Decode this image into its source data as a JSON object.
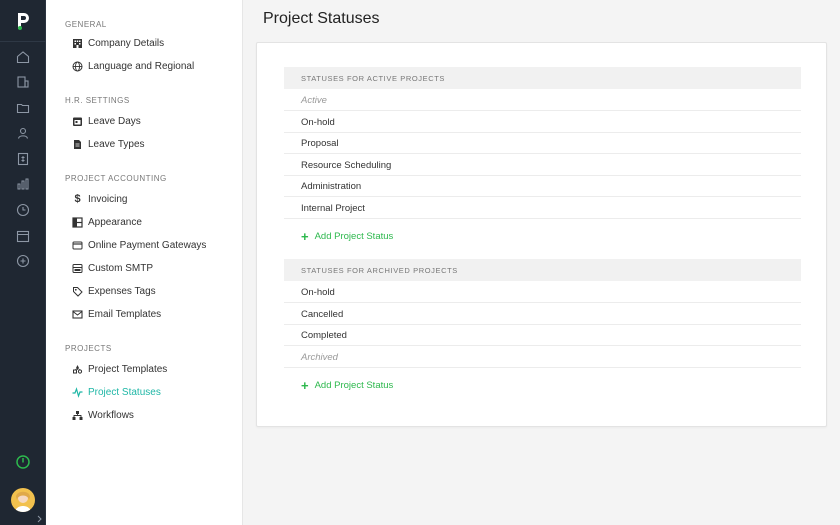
{
  "settings_nav": {
    "sections": [
      {
        "label": "GENERAL",
        "items": [
          {
            "label": "Company Details",
            "icon": "building-icon"
          },
          {
            "label": "Language and Regional",
            "icon": "globe-icon"
          }
        ]
      },
      {
        "label": "H.R. SETTINGS",
        "items": [
          {
            "label": "Leave Days",
            "icon": "calendar-icon"
          },
          {
            "label": "Leave Types",
            "icon": "file-icon"
          }
        ]
      },
      {
        "label": "PROJECT ACCOUNTING",
        "items": [
          {
            "label": "Invoicing",
            "icon": "dollar-icon"
          },
          {
            "label": "Appearance",
            "icon": "layout-icon"
          },
          {
            "label": "Online Payment Gateways",
            "icon": "card-icon"
          },
          {
            "label": "Custom SMTP",
            "icon": "server-icon"
          },
          {
            "label": "Expenses Tags",
            "icon": "tag-icon"
          },
          {
            "label": "Email Templates",
            "icon": "mail-icon"
          }
        ]
      },
      {
        "label": "PROJECTS",
        "items": [
          {
            "label": "Project Templates",
            "icon": "templates-icon"
          },
          {
            "label": "Project Statuses",
            "icon": "pulse-icon",
            "active": true
          },
          {
            "label": "Workflows",
            "icon": "sitemap-icon"
          }
        ]
      }
    ]
  },
  "page": {
    "title": "Project Statuses"
  },
  "active_group": {
    "header": "STATUSES FOR ACTIVE PROJECTS",
    "rows": [
      "Active",
      "On-hold",
      "Proposal",
      "Resource Scheduling",
      "Administration",
      "Internal Project"
    ],
    "add_label": "Add Project Status"
  },
  "archived_group": {
    "header": "STATUSES FOR ARCHIVED PROJECTS",
    "rows": [
      "On-hold",
      "Cancelled",
      "Completed",
      "Archived"
    ],
    "add_label": "Add Project Status"
  },
  "colors": {
    "rail_bg": "#1f2732",
    "accent_teal": "#1fb7a6",
    "accent_green": "#2db84d"
  }
}
